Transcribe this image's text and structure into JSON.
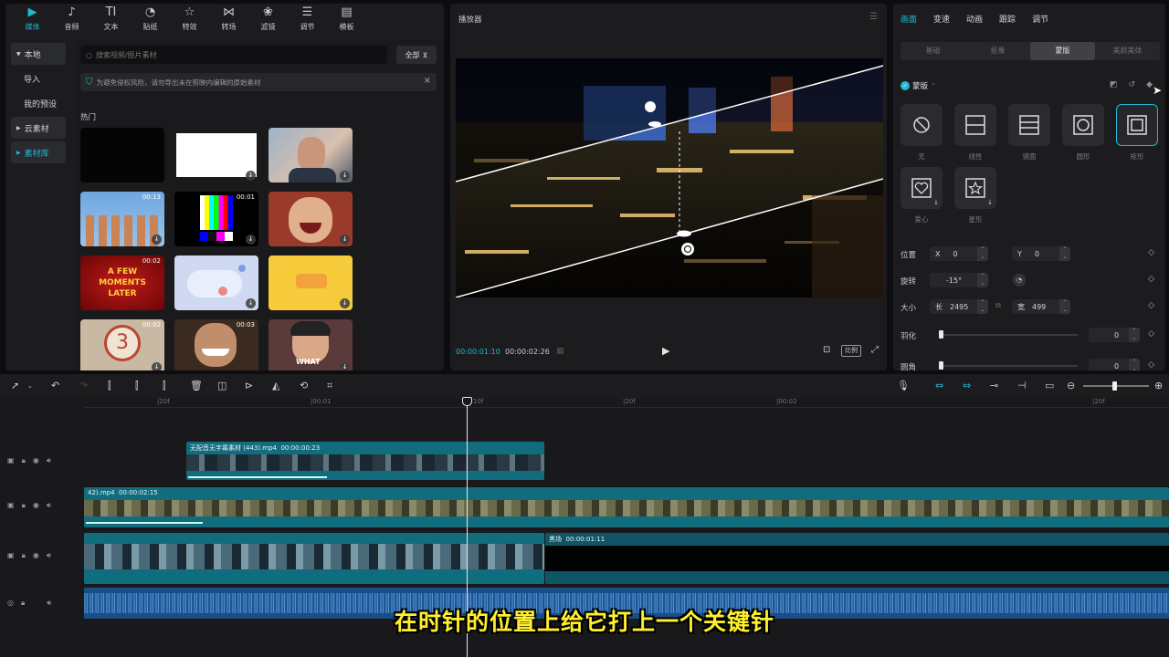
{
  "media_panel": {
    "tabs": [
      {
        "label": "媒体",
        "icon": "media-icon"
      },
      {
        "label": "音频",
        "icon": "audio-icon"
      },
      {
        "label": "文本",
        "icon": "text-icon"
      },
      {
        "label": "贴纸",
        "icon": "sticker-icon"
      },
      {
        "label": "特效",
        "icon": "effects-icon"
      },
      {
        "label": "转场",
        "icon": "transition-icon"
      },
      {
        "label": "滤镜",
        "icon": "filter-icon"
      },
      {
        "label": "调节",
        "icon": "adjust-icon"
      },
      {
        "label": "模板",
        "icon": "template-icon"
      }
    ],
    "side_nav": [
      "本地",
      "导入",
      "我的预设",
      "云素材",
      "素材库"
    ],
    "search_placeholder": "搜索视频/图片素材",
    "filter_label": "全部",
    "notice": "为避免侵权风险，请勿导出未在剪映内编辑的原始素材",
    "section_title": "热门",
    "thumbs": [
      {
        "dur": ""
      },
      {
        "dur": ""
      },
      {
        "dur": ""
      },
      {
        "dur": "00:13"
      },
      {
        "dur": "00:01"
      },
      {
        "dur": ""
      },
      {
        "dur": "00:02",
        "text": "A FEW MOMENTS LATER"
      },
      {
        "dur": ""
      },
      {
        "dur": ""
      },
      {
        "dur": "00:02",
        "text": "3"
      },
      {
        "dur": "00:03"
      },
      {
        "dur": "",
        "text": "WHAT"
      }
    ]
  },
  "player": {
    "title": "播放器",
    "current_time": "00:00:01:10",
    "total_time": "00:00:02:26",
    "ratio_label": "比例"
  },
  "inspector": {
    "tabs": [
      "画面",
      "变速",
      "动画",
      "跟踪",
      "调节"
    ],
    "subtabs": [
      "基础",
      "抠像",
      "蒙版",
      "美颜美体"
    ],
    "mask_title": "蒙版",
    "masks": [
      "无",
      "线性",
      "镜面",
      "圆形",
      "矩形",
      "爱心",
      "星形"
    ],
    "position_label": "位置",
    "pos_x_label": "X",
    "pos_x": "0",
    "pos_y_label": "Y",
    "pos_y": "0",
    "rotate_label": "旋转",
    "rotate": "-15°",
    "size_label": "大小",
    "size_w_label": "长",
    "size_w": "2495",
    "size_h_label": "宽",
    "size_h": "499",
    "feather_label": "羽化",
    "feather": "0",
    "corner_label": "圆角",
    "corner": "0",
    "feather_level": 0,
    "corner_level": 0
  },
  "timeline": {
    "ruler": [
      "|20f",
      "|00:01",
      "|20f",
      "|00:02",
      "|20f"
    ],
    "playhead_label": "10f",
    "clips": [
      {
        "name": "无配音无字幕素材 (443).mp4",
        "dur": "00:00:00:23"
      },
      {
        "name": "42).mp4",
        "dur": "00:00:02:15"
      },
      {
        "name": "黑场",
        "dur": "00:00:01:11"
      }
    ]
  },
  "subtitle": "在时针的位置上给它打上一个关键针",
  "colors": {
    "accent": "#21b8d4",
    "clip": "#116c7e",
    "audio": "#1b4d86",
    "subtitle": "#fff02e"
  }
}
